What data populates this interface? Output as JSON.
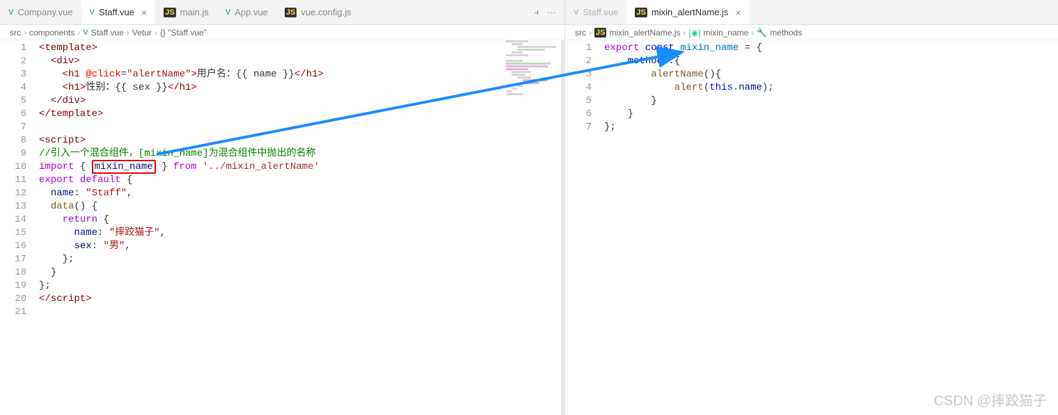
{
  "left_pane": {
    "tabs": [
      {
        "icon": "vue",
        "label": "Company.vue",
        "active": false
      },
      {
        "icon": "vue",
        "label": "Staff.vue",
        "active": true
      },
      {
        "icon": "js",
        "label": "main.js",
        "active": false
      },
      {
        "icon": "vue",
        "label": "App.vue",
        "active": false
      },
      {
        "icon": "js",
        "label": "vue.config.js",
        "active": false
      }
    ],
    "breadcrumb": [
      "src",
      "components",
      "Staff.vue",
      "Vetur",
      "{} \"Staff.vue\""
    ],
    "code_lines": [
      {
        "n": 1,
        "html": "<span class='tok-tag'>&lt;template&gt;</span>"
      },
      {
        "n": 2,
        "html": "  <span class='tok-tag'>&lt;div&gt;</span>"
      },
      {
        "n": 3,
        "html": "    <span class='tok-tag'>&lt;h1</span> <span class='tok-attr'>@click</span>=<span class='tok-str'>\"alertName\"</span><span class='tok-tag'>&gt;</span>用户名：{{ name }}<span class='tok-tag'>&lt;/h1&gt;</span>"
      },
      {
        "n": 4,
        "html": "    <span class='tok-tag'>&lt;h1&gt;</span>性别：{{ sex }}<span class='tok-tag'>&lt;/h1&gt;</span>"
      },
      {
        "n": 5,
        "html": "  <span class='tok-tag'>&lt;/div&gt;</span>"
      },
      {
        "n": 6,
        "html": "<span class='tok-tag'>&lt;/template&gt;</span>"
      },
      {
        "n": 7,
        "html": ""
      },
      {
        "n": 8,
        "html": "<span class='tok-tag'>&lt;script&gt;</span>"
      },
      {
        "n": 9,
        "html": "<span class='tok-comment'>//引入一个混合组件，[mixin_name]为混合组件中抛出的名称</span>"
      },
      {
        "n": 10,
        "html": "<span class='tok-kw2'>import</span> <span class='tok-brace'>{</span> <span class='highlight-box'><span class='tok-var'>mixin_name</span></span> <span class='tok-brace'>}</span> <span class='tok-kw2'>from</span> <span class='tok-str2'>'../mixin_alertName'</span>"
      },
      {
        "n": 11,
        "html": "<span class='tok-kw2'>export</span> <span class='tok-kw2'>default</span> <span class='tok-brace'>{</span>"
      },
      {
        "n": 12,
        "html": "  <span class='tok-var'>name</span>: <span class='tok-str'>\"Staff\"</span>,"
      },
      {
        "n": 13,
        "html": "  <span class='tok-func'>data</span>() <span class='tok-brace'>{</span>"
      },
      {
        "n": 14,
        "html": "    <span class='tok-kw2'>return</span> <span class='tok-brace'>{</span>"
      },
      {
        "n": 15,
        "html": "      <span class='tok-var'>name</span>: <span class='tok-str'>\"摔跤猫子\"</span>,"
      },
      {
        "n": 16,
        "html": "      <span class='tok-var'>sex</span>: <span class='tok-str'>\"男\"</span>,"
      },
      {
        "n": 17,
        "html": "    <span class='tok-brace'>}</span>;"
      },
      {
        "n": 18,
        "html": "  <span class='tok-brace'>}</span>"
      },
      {
        "n": 19,
        "html": "<span class='tok-brace'>}</span>;"
      },
      {
        "n": 20,
        "html": "<span class='tok-tag'>&lt;/script&gt;</span>"
      },
      {
        "n": 21,
        "html": ""
      }
    ]
  },
  "right_pane": {
    "tabs": [
      {
        "icon": "vue",
        "label": "Staff.vue",
        "active": false,
        "dim": true
      },
      {
        "icon": "js",
        "label": "mixin_alertName.js",
        "active": true
      }
    ],
    "breadcrumb": [
      "src",
      "mixin_alertName.js",
      "mixin_name",
      "methods"
    ],
    "code_lines": [
      {
        "n": 1,
        "html": "<span class='tok-kw2'>export</span> <span class='tok-kw'>const</span> <span class='tok-const'>mixin_name</span> = <span class='tok-brace'>{</span>"
      },
      {
        "n": 2,
        "html": "    <span class='tok-var'>methods</span>:<span class='tok-brace'>{</span>"
      },
      {
        "n": 3,
        "html": "        <span class='tok-func'>alertName</span>()<span class='tok-brace'>{</span>"
      },
      {
        "n": 4,
        "html": "            <span class='tok-func'>alert</span>(<span class='tok-kw'>this</span>.<span class='tok-var'>name</span>);"
      },
      {
        "n": 5,
        "html": "        <span class='tok-brace'>}</span>"
      },
      {
        "n": 6,
        "html": "    <span class='tok-brace'>}</span>"
      },
      {
        "n": 7,
        "html": "<span class='tok-brace'>}</span>;"
      }
    ]
  },
  "watermark": "CSDN @摔跤猫子",
  "icons": {
    "close": "×",
    "split": "⫞",
    "more": "···",
    "sep": "›",
    "vue_badge": "V",
    "js_badge": "JS",
    "wrench": "🔧"
  }
}
